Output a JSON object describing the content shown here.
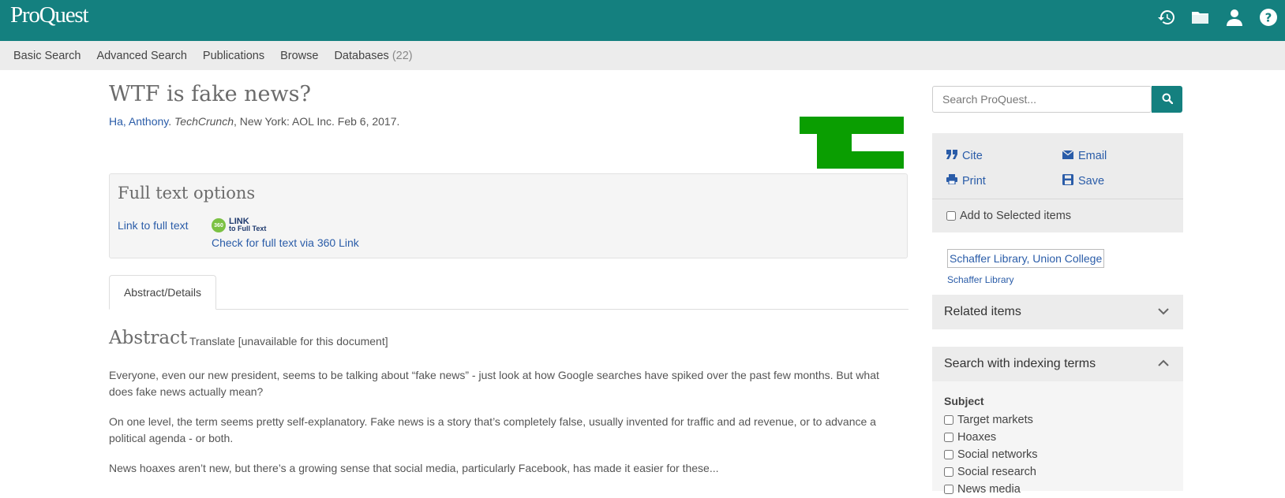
{
  "brand": {
    "logo": "ProQuest",
    "topbar_color": "#14807f",
    "link_color": "#2a5ca8"
  },
  "top_icons": [
    "history-icon",
    "folder-icon",
    "user-icon",
    "help-icon"
  ],
  "nav": {
    "items": [
      "Basic Search",
      "Advanced Search",
      "Publications",
      "Browse"
    ],
    "databases_label": "Databases",
    "databases_count": "(22)"
  },
  "document": {
    "title": "WTF is fake news?",
    "author": "Ha, Anthony",
    "author_sep": ".",
    "publication": "TechCrunch",
    "citation_rest": ", New York: AOL Inc. Feb 6, 2017."
  },
  "fulltext": {
    "heading": "Full text options",
    "link_label": "Link to full text",
    "link360_badge": "360",
    "link360_line1": "LINK",
    "link360_line2": "to Full Text",
    "link360_check": "Check for full text via 360 Link"
  },
  "tabs": {
    "abstract_details": "Abstract/Details"
  },
  "abstract": {
    "heading": "Abstract",
    "translate": "Translate [unavailable for this document]",
    "paragraphs": [
      "Everyone, even our new president, seems to be talking about “fake news” - just look at how Google searches have spiked over the past few months. But what does fake news actually mean?",
      "On one level, the term seems pretty self-explanatory. Fake news is a story that’s completely false, usually invented for traffic and ad revenue, or to advance a political agenda - or both.",
      "News hoaxes aren’t new, but there’s a growing sense that social media, particularly Facebook, has made it easier for these..."
    ]
  },
  "search": {
    "placeholder": "Search ProQuest..."
  },
  "actions": {
    "cite": "Cite",
    "email": "Email",
    "print": "Print",
    "save": "Save",
    "add_selected": "Add to Selected items"
  },
  "library": {
    "image_alt": "Schaffer Library, Union College",
    "caption": "Schaffer Library"
  },
  "panels": {
    "related": "Related items",
    "indexing": "Search with indexing terms",
    "subject_label": "Subject",
    "subjects": [
      "Target markets",
      "Hoaxes",
      "Social networks",
      "Social research",
      "News media"
    ]
  }
}
